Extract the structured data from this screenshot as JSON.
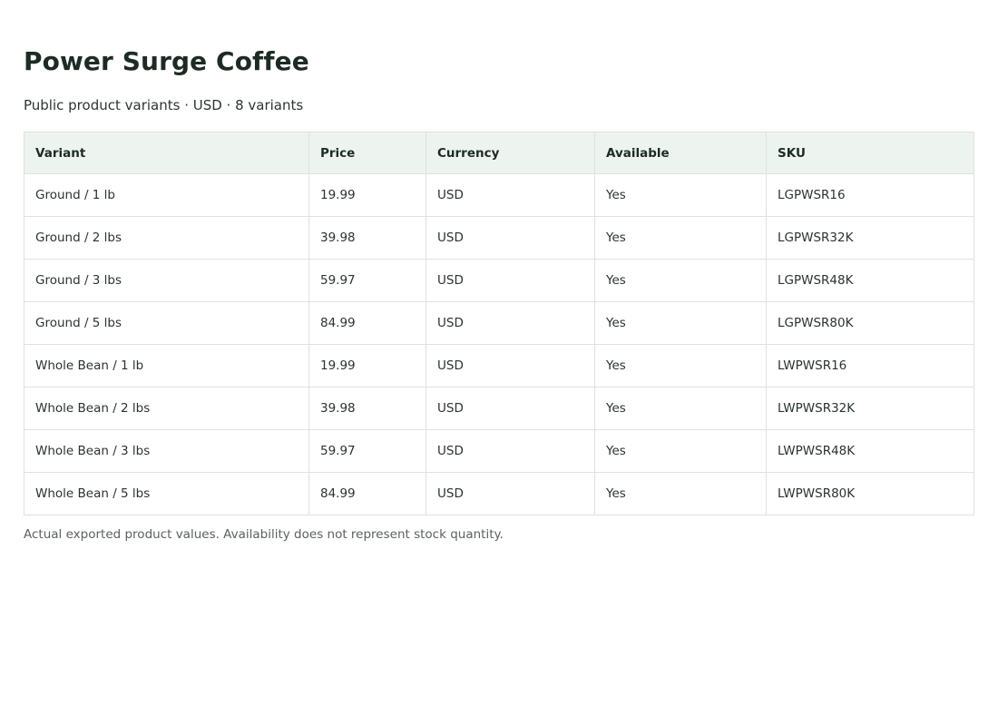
{
  "page": {
    "title": "Power Surge Coffee",
    "subtitle": "Public product variants · USD · 8 variants",
    "footnote": "Actual exported product values. Availability does not represent stock quantity."
  },
  "table": {
    "headers": [
      "Variant",
      "Price",
      "Currency",
      "Available",
      "SKU"
    ],
    "rows": [
      [
        "Ground / 1 lb",
        "19.99",
        "USD",
        "Yes",
        "LGPWSR16"
      ],
      [
        "Ground / 2 lbs",
        "39.98",
        "USD",
        "Yes",
        "LGPWSR32K"
      ],
      [
        "Ground / 3 lbs",
        "59.97",
        "USD",
        "Yes",
        "LGPWSR48K"
      ],
      [
        "Ground / 5 lbs",
        "84.99",
        "USD",
        "Yes",
        "LGPWSR80K"
      ],
      [
        "Whole Bean / 1 lb",
        "19.99",
        "USD",
        "Yes",
        "LWPWSR16"
      ],
      [
        "Whole Bean / 2 lbs",
        "39.98",
        "USD",
        "Yes",
        "LWPWSR32K"
      ],
      [
        "Whole Bean / 3 lbs",
        "59.97",
        "USD",
        "Yes",
        "LWPWSR48K"
      ],
      [
        "Whole Bean / 5 lbs",
        "84.99",
        "USD",
        "Yes",
        "LWPWSR80K"
      ]
    ]
  }
}
